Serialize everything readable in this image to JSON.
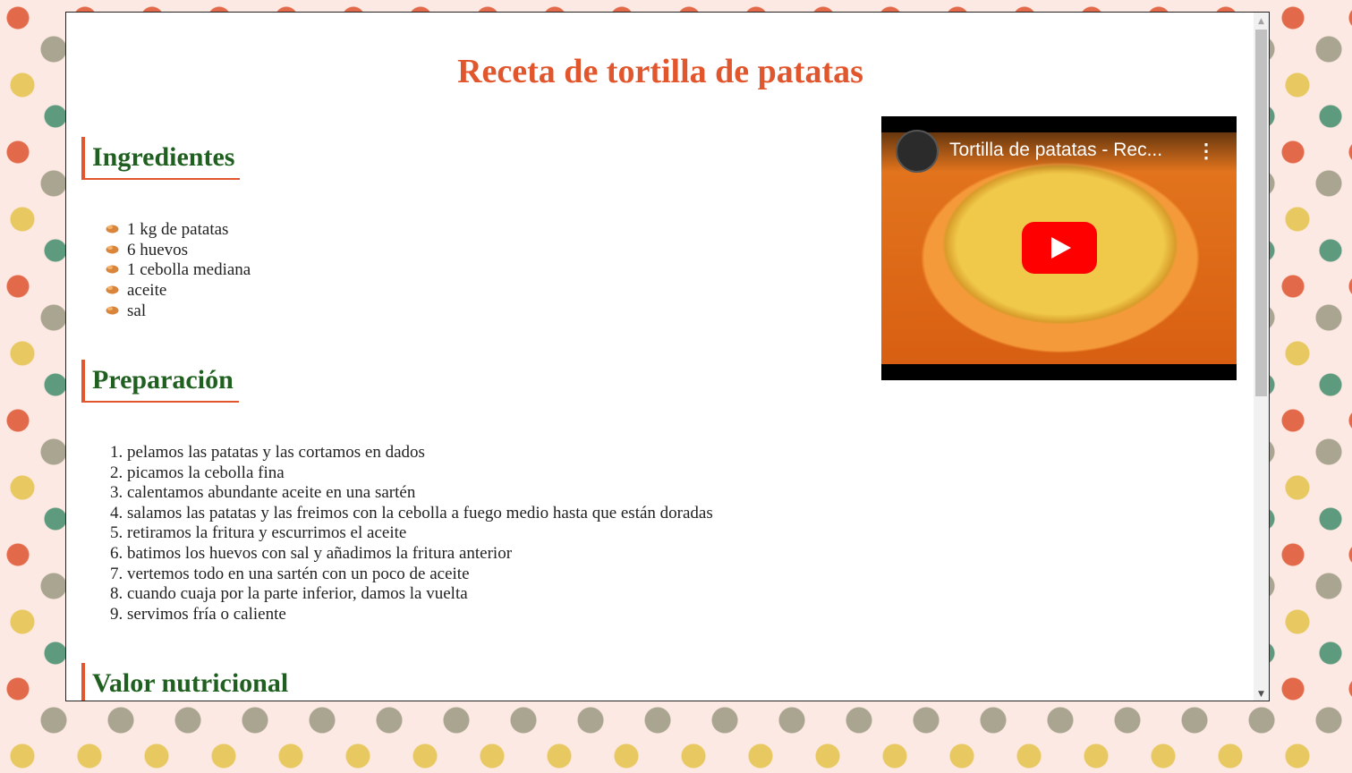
{
  "page": {
    "title": "Receta de tortilla de patatas",
    "sections": {
      "ingredients_title": "Ingredientes",
      "preparation_title": "Preparación",
      "nutrition_title": "Valor nutricional"
    },
    "ingredients": [
      "1 kg de patatas",
      "6 huevos",
      "1 cebolla mediana",
      "aceite",
      "sal"
    ],
    "steps": [
      "pelamos las patatas y las cortamos en dados",
      "picamos la cebolla fina",
      "calentamos abundante aceite en una sartén",
      "salamos las patatas y las freimos con la cebolla a fuego medio hasta que están doradas",
      "retiramos la fritura y escurrimos el aceite",
      "batimos los huevos con sal y añadimos la fritura anterior",
      "vertemos todo en una sartén con un poco de aceite",
      "cuando cuaja por la parte inferior, damos la vuelta",
      "servimos fría o caliente"
    ],
    "video": {
      "title": "Tortilla de patatas - Rec...",
      "more_icon": "⋮"
    }
  },
  "scrollbar": {
    "up": "▲",
    "down": "▼"
  },
  "colors": {
    "title": "#e2562d",
    "heading": "#1f5f1f",
    "accent_border": "#e2562d",
    "play_button": "#ff0000"
  }
}
